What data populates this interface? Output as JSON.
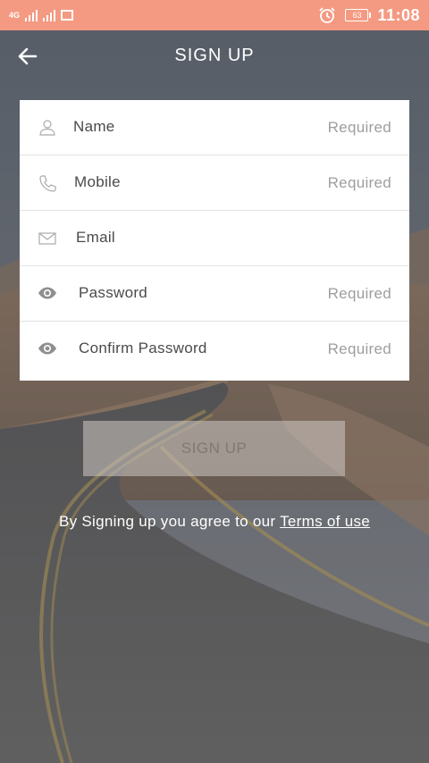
{
  "status_bar": {
    "network_label": "4G",
    "battery_level": "63",
    "time": "11:08"
  },
  "header": {
    "title": "SIGN UP"
  },
  "form": {
    "fields": [
      {
        "label": "Name",
        "hint": "Required",
        "icon": "person-icon"
      },
      {
        "label": "Mobile",
        "hint": "Required",
        "icon": "phone-icon"
      },
      {
        "label": "Email",
        "hint": "",
        "icon": "mail-icon"
      },
      {
        "label": "Password",
        "hint": "Required",
        "icon": "eye-icon"
      },
      {
        "label": "Confirm Password",
        "hint": "Required",
        "icon": "eye-icon"
      }
    ]
  },
  "actions": {
    "signup_label": "SIGN UP"
  },
  "terms": {
    "prefix": "By Signing up you agree to our",
    "link": "Terms of use"
  },
  "colors": {
    "status_bar": "#f49a82",
    "card": "#ffffff",
    "label_text": "#4a4a4a",
    "hint_text": "#9e9e9e"
  }
}
